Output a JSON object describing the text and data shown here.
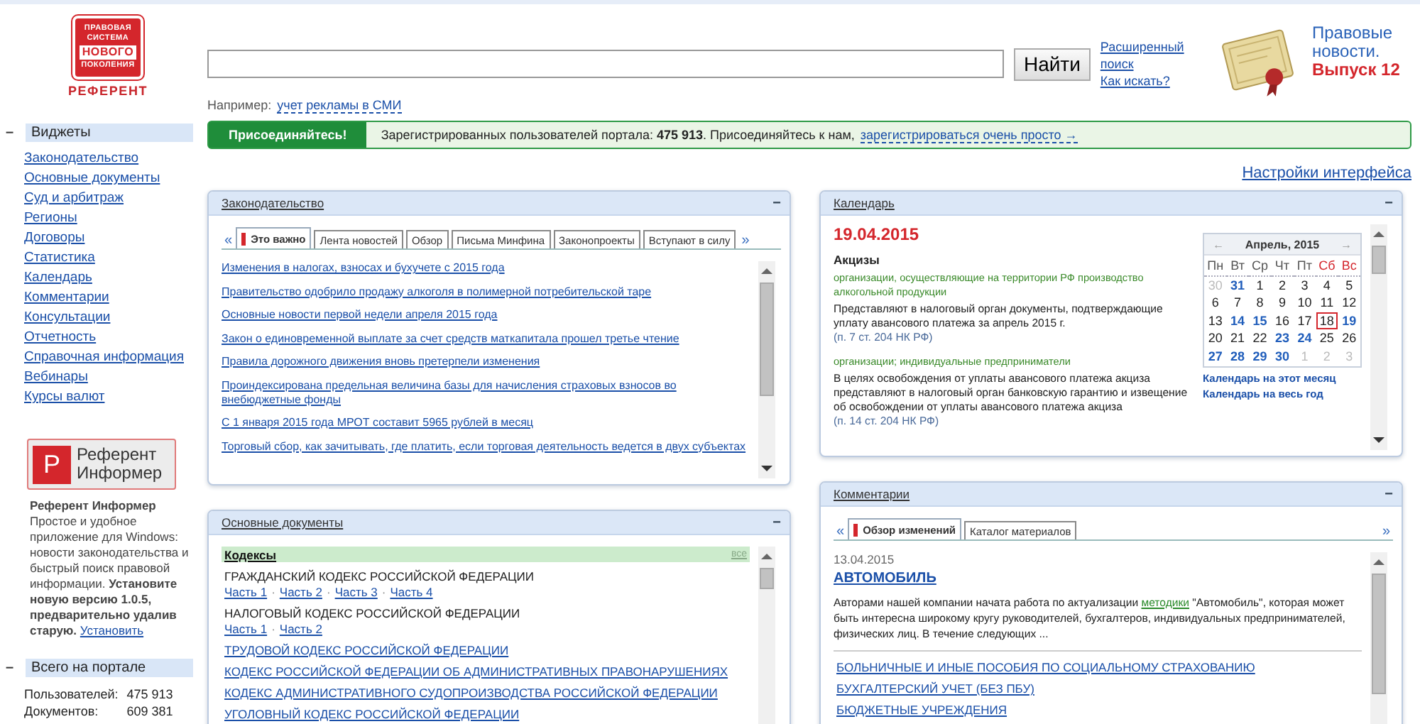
{
  "logo": {
    "lines": [
      "ПРАВОВАЯ",
      "СИСТЕМА",
      "НОВОГО",
      "ПОКОЛЕНИЯ"
    ],
    "name": "РЕФЕРЕНТ"
  },
  "sidebar": {
    "widgets": {
      "collapse": "–",
      "title": "Виджеты",
      "items": [
        "Законодательство",
        "Основные документы",
        "Суд и арбитраж",
        "Регионы",
        "Договоры",
        "Статистика",
        "Календарь",
        "Комментарии",
        "Консультации",
        "Отчетность",
        "Справочная информация",
        "Вебинары",
        "Курсы валют"
      ]
    },
    "informer": {
      "letter": "Р",
      "label": "Референт Информер",
      "title": "Референт Информер",
      "text": "Простое и удобное приложение для Windows: новости законодательства и быстрый поиск правовой информации. **Установите новую версию 1.0.5, предварительно удалив старую.**",
      "link": "Установить"
    },
    "stats": {
      "collapse": "–",
      "title": "Всего на портале",
      "rows": [
        {
          "label": "Пользователей:",
          "value": "475 913"
        },
        {
          "label": "Документов:",
          "value": "609 381"
        }
      ]
    }
  },
  "search": {
    "button": "Найти",
    "hint": "Например:",
    "example": "учет рекламы в СМИ",
    "links": [
      "Расширенный поиск",
      "Как искать?"
    ]
  },
  "promo": {
    "line": "Правовые новости.",
    "issue": "Выпуск 12"
  },
  "join": {
    "button": "Присоединяйтесь!",
    "text": "Зарегистрированных пользователей портала: **475 913**. Присоединяйтесь к нам,",
    "link": "зарегистрироваться очень просто →"
  },
  "settings_link": "Настройки интерфейса",
  "legislation": {
    "title": "Законодательство",
    "collapse": "−",
    "prev": "«",
    "next": "»",
    "tabs": [
      {
        "label": "Это важно",
        "selected": true
      },
      {
        "label": "Лента новостей",
        "selected": false
      },
      {
        "label": "Обзор",
        "selected": false
      },
      {
        "label": "Письма Минфина",
        "selected": false
      },
      {
        "label": "Законопроекты",
        "selected": false
      },
      {
        "label": "Вступают в силу",
        "selected": false
      }
    ],
    "items": [
      "Изменения в налогах, взносах и бухучете с 2015 года",
      "Правительство одобрило продажу алкоголя в полимерной потребительской таре",
      "Основные новости первой недели апреля 2015 года",
      "Закон о единовременной выплате за счет средств маткапитала прошел третье чтение",
      "Правила дорожного движения вновь претерпели изменения",
      "Проиндексирована предельная величина базы для начисления страховых взносов во внебюджетные фонды",
      "С 1 января 2015 года МРОТ составит 5965 рублей в месяц",
      "Торговый сбор, как зачитывать, где платить, если торговая деятельность ведется в двух субъектах"
    ]
  },
  "documents": {
    "title": "Основные документы",
    "collapse": "−",
    "section": "Кодексы",
    "all_link": "все",
    "entries": [
      {
        "kind": "parts",
        "title": "ГРАЖДАНСКИЙ КОДЕКС РОССИЙСКОЙ ФЕДЕРАЦИИ",
        "parts": [
          "Часть 1",
          "Часть 2",
          "Часть 3",
          "Часть 4"
        ],
        "separator": "·"
      },
      {
        "kind": "parts",
        "title": "НАЛОГОВЫЙ КОДЕКС РОССИЙСКОЙ ФЕДЕРАЦИИ",
        "parts": [
          "Часть 1",
          "Часть 2"
        ],
        "separator": "·"
      },
      {
        "kind": "link",
        "title": "ТРУДОВОЙ КОДЕКС РОССИЙСКОЙ ФЕДЕРАЦИИ"
      },
      {
        "kind": "link",
        "title": "КОДЕКС РОССИЙСКОЙ ФЕДЕРАЦИИ ОБ АДМИНИСТРАТИВНЫХ ПРАВОНАРУШЕНИЯХ"
      },
      {
        "kind": "link",
        "title": "КОДЕКС АДМИНИСТРАТИВНОГО СУДОПРОИЗВОДСТВА РОССИЙСКОЙ ФЕДЕРАЦИИ"
      },
      {
        "kind": "link",
        "title": "УГОЛОВНЫЙ КОДЕКС РОССИЙСКОЙ ФЕДЕРАЦИИ"
      }
    ]
  },
  "calendar": {
    "title": "Календарь",
    "collapse": "−",
    "date": "19.04.2015",
    "heading": "Акцизы",
    "entries": [
      {
        "audience": "организации, осуществляющие на территории РФ производство алкогольной продукции",
        "text": "Представляют в налоговый орган документы, подтверждающие уплату авансового платежа за апрель 2015 г.",
        "ref": "(п. 7 ст. 204 НК РФ)"
      },
      {
        "audience": "организации; индивидуальные предприниматели",
        "text": "В целях освобождения от уплаты авансового платежа акциза представляют в налоговый орган банковскую гарантию и извещение об освобождении от уплаты авансового платежа акциза",
        "ref": "(п. 14 ст. 204 НК РФ)"
      }
    ],
    "widget": {
      "prev": "←",
      "month": "Апрель, 2015",
      "next": "→",
      "weekdays": [
        {
          "label": "Пн",
          "weekend": false
        },
        {
          "label": "Вт",
          "weekend": false
        },
        {
          "label": "Ср",
          "weekend": false
        },
        {
          "label": "Чт",
          "weekend": false
        },
        {
          "label": "Пт",
          "weekend": false
        },
        {
          "label": "Сб",
          "weekend": true
        },
        {
          "label": "Вс",
          "weekend": true
        }
      ],
      "weeks": [
        [
          {
            "day": "30",
            "kind": "other"
          },
          {
            "day": "31",
            "kind": "event"
          },
          {
            "day": "1",
            "kind": "plain"
          },
          {
            "day": "2",
            "kind": "plain"
          },
          {
            "day": "3",
            "kind": "plain"
          },
          {
            "day": "4",
            "kind": "plain"
          },
          {
            "day": "5",
            "kind": "plain"
          }
        ],
        [
          {
            "day": "6",
            "kind": "plain"
          },
          {
            "day": "7",
            "kind": "plain"
          },
          {
            "day": "8",
            "kind": "plain"
          },
          {
            "day": "9",
            "kind": "plain"
          },
          {
            "day": "10",
            "kind": "plain"
          },
          {
            "day": "11",
            "kind": "plain"
          },
          {
            "day": "12",
            "kind": "plain"
          }
        ],
        [
          {
            "day": "13",
            "kind": "plain"
          },
          {
            "day": "14",
            "kind": "event"
          },
          {
            "day": "15",
            "kind": "event"
          },
          {
            "day": "16",
            "kind": "plain"
          },
          {
            "day": "17",
            "kind": "plain"
          },
          {
            "day": "18",
            "kind": "today"
          },
          {
            "day": "19",
            "kind": "event"
          }
        ],
        [
          {
            "day": "20",
            "kind": "plain"
          },
          {
            "day": "21",
            "kind": "plain"
          },
          {
            "day": "22",
            "kind": "plain"
          },
          {
            "day": "23",
            "kind": "event"
          },
          {
            "day": "24",
            "kind": "event"
          },
          {
            "day": "25",
            "kind": "plain"
          },
          {
            "day": "26",
            "kind": "plain"
          }
        ],
        [
          {
            "day": "27",
            "kind": "event"
          },
          {
            "day": "28",
            "kind": "event"
          },
          {
            "day": "29",
            "kind": "event"
          },
          {
            "day": "30",
            "kind": "event"
          },
          {
            "day": "1",
            "kind": "other"
          },
          {
            "day": "2",
            "kind": "other"
          },
          {
            "day": "3",
            "kind": "other"
          }
        ]
      ],
      "links": [
        "Календарь на этот месяц",
        "Календарь на весь год"
      ]
    }
  },
  "comments": {
    "title": "Комментарии",
    "collapse": "−",
    "prev": "«",
    "next": "»",
    "tabs": [
      {
        "label": "Обзор изменений",
        "selected": true
      },
      {
        "label": "Каталог материалов",
        "selected": false
      }
    ],
    "date": "13.04.2015",
    "heading": "АВТОМОБИЛЬ",
    "text_before": "Авторами нашей компании начата работа по актуализации",
    "text_link": "методики",
    "text_after": "\"Автомобиль\", которая может быть интересна широкому кругу руководителей, бухгалтеров, индивидуальных предпринимателей, физических лиц. В течение следующих ...",
    "items": [
      "БОЛЬНИЧНЫЕ И ИНЫЕ ПОСОБИЯ ПО СОЦИАЛЬНОМУ СТРАХОВАНИЮ",
      "БУХГАЛТЕРСКИЙ УЧЕТ (БЕЗ ПБУ)",
      "БЮДЖЕТНЫЕ УЧРЕЖДЕНИЯ"
    ]
  }
}
